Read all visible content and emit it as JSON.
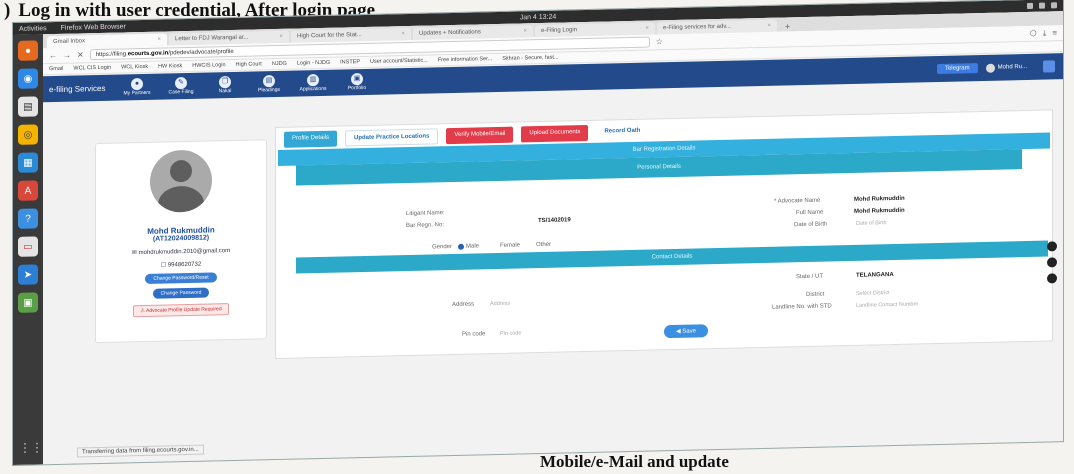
{
  "doc": {
    "heading_number": ")",
    "heading": "Log in with user credential, After login page",
    "footer_fragment": "Mobile/e-Mail and update"
  },
  "os": {
    "app_label": "Activities",
    "browser_label": "Firefox Web Browser",
    "clock": "Jan 4 13:24"
  },
  "browser": {
    "tabs": [
      "Gmail Inbox",
      "Letter to FDJ Warangal ar...",
      "High Court for the Stat...",
      "Updates + Notifications",
      "e-Filing Login",
      "e-Filing services for adv..."
    ],
    "url_prefix": "https://filing.",
    "url_domain": "ecourts.gov.in",
    "url_suffix": "/pdedev/advocate/profile",
    "bookmarks": [
      "Gmail",
      "WCL CIS Login",
      "WCL Kiosk",
      "HW Kiosk",
      "HWCIS Login",
      "High Court",
      "NJDG",
      "Login - NJDG",
      "INSTEP",
      "User account/Statistic...",
      "Free information Ser...",
      "Sithran - Secure, fast..."
    ]
  },
  "efiling": {
    "brand": "e-filing Services",
    "nav": [
      "My Partners",
      "Case Filing",
      "Nakal",
      "Pleadings",
      "Applications",
      "Portfolio"
    ],
    "telegram": "Telegram",
    "user": "Mohd Ru..."
  },
  "profile": {
    "name": "Mohd Rukmuddin",
    "enrolment": "(AT12024009812)",
    "email": "mohdrukmuddin.2010@gmail.com",
    "phone": "9948620732",
    "pill1": "Change Password/Reset",
    "pill2": "Change Password",
    "warning": "Advocate Profile Update Required"
  },
  "form": {
    "buttons": {
      "profile": "Profile Details",
      "update": "Update Practice Locations",
      "verify": "Verify Mobile/Email",
      "upload": "Upload Documents",
      "record": "Record Oath"
    },
    "bar_info": "Bar Registration Details",
    "bar_personal": "Personal Details",
    "litigant_label": "Litigant Name:",
    "bar_reg_label": "Bar Regn. No:",
    "bar_reg_value": "TS/1402019",
    "adv_name_label": "* Advocate Name",
    "adv_name_value": "Mohd Rukmuddin",
    "full_name_label": "Full Name",
    "full_name_value": "Mohd Rukmuddin",
    "dob_label": "Date of Birth",
    "dob_placeholder": "Date of Birth",
    "gender_label": "Gender",
    "gender_options": [
      "Male",
      "Female",
      "Other"
    ],
    "bar_contact": "Contact Details",
    "state_label": "State / UT",
    "state_value": "TELANGANA",
    "address_label": "Address",
    "address_placeholder": "Address",
    "district_label": "District",
    "district_value": "Select District",
    "pin_label": "Pin code",
    "pin_placeholder": "Pin code",
    "landline_label": "Landline No. with STD",
    "landline_placeholder": "Landline Contact Number",
    "save": "Save"
  },
  "status": "Transferring data from filing.ecourts.gov.in..."
}
